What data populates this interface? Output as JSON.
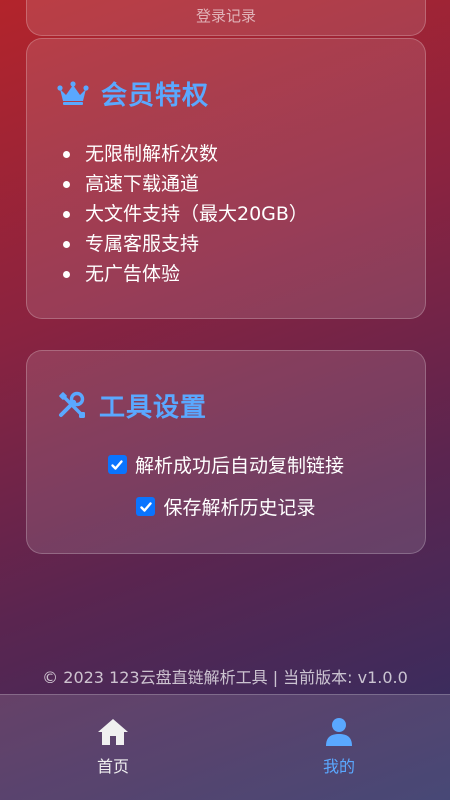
{
  "top_card": {
    "login_records": "登录记录"
  },
  "member": {
    "title": "会员特权",
    "icon": "crown-icon",
    "benefits": [
      "无限制解析次数",
      "高速下载通道",
      "大文件支持（最大20GB）",
      "专属客服支持",
      "无广告体验"
    ]
  },
  "tools": {
    "title": "工具设置",
    "icon": "tools-icon",
    "options": [
      {
        "label": "解析成功后自动复制链接",
        "checked": true
      },
      {
        "label": "保存解析历史记录",
        "checked": true
      }
    ]
  },
  "footer": {
    "text": "© 2023 123云盘直链解析工具 | 当前版本: v1.0.0"
  },
  "tabbar": {
    "items": [
      {
        "label": "首页",
        "icon": "home-icon",
        "active": false
      },
      {
        "label": "我的",
        "icon": "user-icon",
        "active": true
      }
    ]
  },
  "colors": {
    "accent": "#5aa8ff",
    "checkbox": "#0a74ff"
  }
}
